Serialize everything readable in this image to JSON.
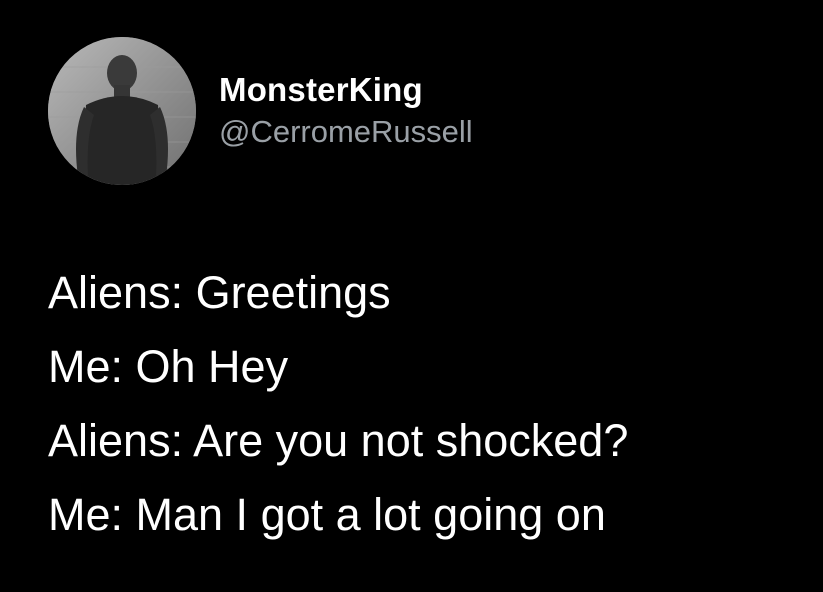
{
  "author": {
    "display_name": "MonsterKing",
    "handle": "@CerromeRussell",
    "avatar": "profile-photo"
  },
  "tweet": {
    "lines": [
      "Aliens: Greetings",
      "Me: Oh Hey",
      "Aliens: Are you not shocked?",
      "Me: Man I got a lot going on"
    ]
  },
  "colors": {
    "background": "#000000",
    "text": "#ffffff",
    "handle": "#9aa0a6"
  }
}
